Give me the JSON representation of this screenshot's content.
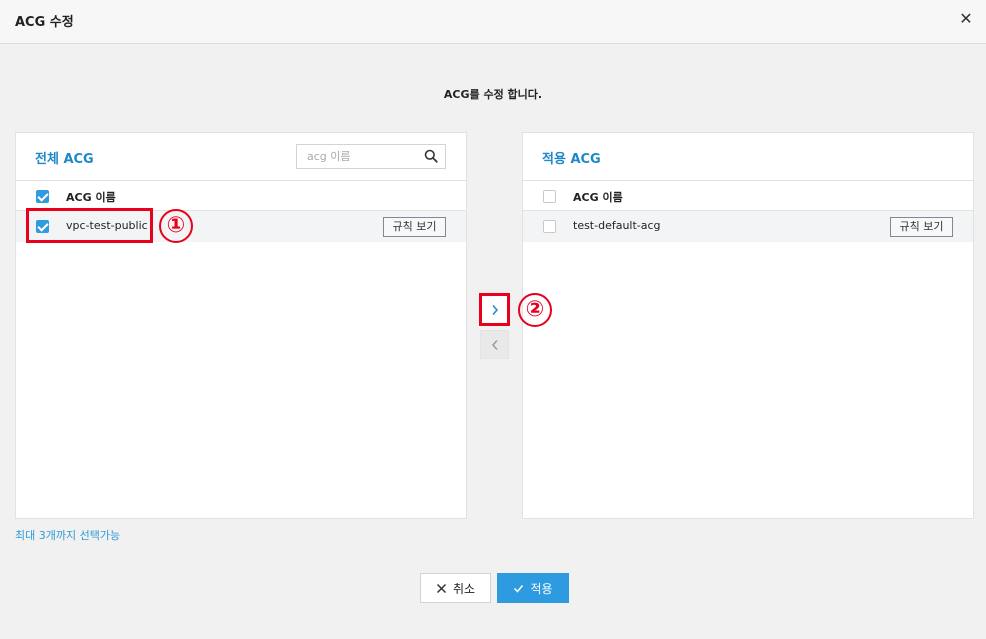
{
  "dialog": {
    "title": "ACG 수정",
    "description": "ACG를 수정 합니다."
  },
  "left_panel": {
    "title": "전체 ACG",
    "search_placeholder": "acg 이름",
    "column_header": "ACG 이름",
    "header_checked": true,
    "rows": [
      {
        "name": "vpc-test-public",
        "checked": true,
        "rule_button": "규칙 보기"
      }
    ]
  },
  "right_panel": {
    "title": "적용 ACG",
    "column_header": "ACG 이름",
    "header_checked": false,
    "rows": [
      {
        "name": "test-default-acg",
        "checked": false,
        "rule_button": "규칙 보기"
      }
    ]
  },
  "annotations": {
    "marker1": "①",
    "marker2": "②"
  },
  "limit_text": "최대 3개까지 선택가능",
  "footer": {
    "cancel_label": "취소",
    "apply_label": "적용"
  },
  "colors": {
    "accent": "#2e9be0",
    "highlight": "#e8001c",
    "title_blue": "#1e88c9"
  },
  "icons": {
    "close": "close-icon",
    "search": "search-icon",
    "move_right": "chevron-right-icon",
    "move_left": "chevron-left-icon",
    "cancel": "x-icon",
    "apply": "check-icon"
  }
}
